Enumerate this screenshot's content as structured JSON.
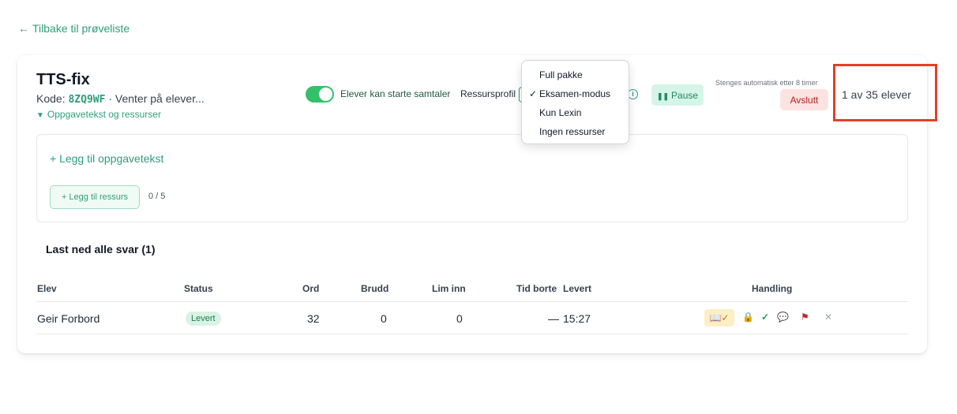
{
  "nav": {
    "back_label": "Tilbake til prøveliste"
  },
  "test": {
    "title": "TTS-fix",
    "code_label": "Kode:",
    "code": "8ZQ9WF",
    "status_text": "· Venter på elever...",
    "resources_toggle": "Oppgavetekst og ressurser"
  },
  "controls": {
    "toggle_label": "Elever kan starte samtaler",
    "toggle_on": true,
    "resource_profile_label": "Ressursprofil",
    "resource_profile_options": [
      "Full pakke",
      "Eksamen-modus",
      "Kun Lexin",
      "Ingen ressurser"
    ],
    "resource_profile_selected": "Eksamen-modus",
    "pause_label": "Pause",
    "auto_close_text": "Stenges automatisk etter 8 timer",
    "end_label": "Avslutt",
    "student_count": "1 av 35 elever"
  },
  "resources": {
    "add_text_label": "+ Legg til oppgavetekst",
    "add_resource_label": "+ Legg til ressurs",
    "resource_count": "0 / 5"
  },
  "table": {
    "download_all": "Last ned alle svar (1)",
    "headers": [
      "Elev",
      "Status",
      "Ord",
      "Brudd",
      "Lim inn",
      "Tid borte",
      "Levert",
      "Handling"
    ],
    "rows": [
      {
        "student": "Geir Forbord",
        "status": "Levert",
        "words": "32",
        "breaches": "0",
        "pastes": "0",
        "time_away": "—",
        "delivered": "15:27"
      }
    ]
  },
  "colors": {
    "accent": "#2f9e78",
    "highlight": "#e53e2a",
    "danger": "#b42318"
  }
}
